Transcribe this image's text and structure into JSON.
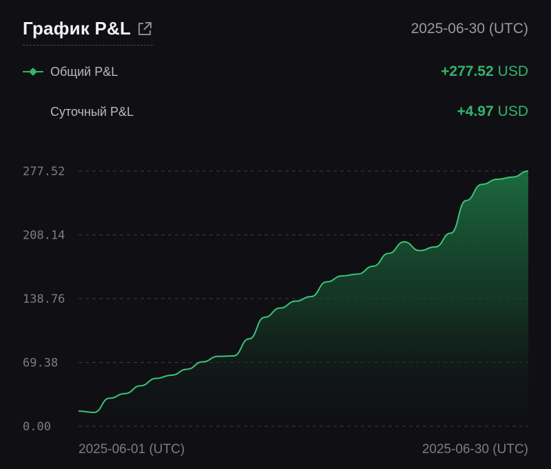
{
  "header": {
    "title": "График P&L",
    "date": "2025-06-30 (UTC)",
    "external_link_icon": "external-link-icon"
  },
  "summary": {
    "total": {
      "label": "Общий P&L",
      "value": "+277.52",
      "unit": "USD",
      "marker_icon": "diamond-line-marker"
    },
    "daily": {
      "label": "Суточный P&L",
      "value": "+4.97",
      "unit": "USD"
    }
  },
  "colors": {
    "background": "#101014",
    "accent": "#32b56b",
    "line": "#3cc478",
    "grid": "#3a3a40",
    "muted_text": "#7c7c84"
  },
  "chart_data": {
    "type": "area",
    "title": "",
    "xlabel": "",
    "ylabel": "",
    "ylim": [
      0,
      277.52
    ],
    "y_ticks": [
      0.0,
      69.38,
      138.76,
      208.14,
      277.52
    ],
    "y_tick_labels": [
      "0.00",
      "69.38",
      "138.76",
      "208.14",
      "277.52"
    ],
    "x_tick_labels": [
      "2025-06-01 (UTC)",
      "2025-06-30 (UTC)"
    ],
    "grid": true,
    "series": [
      {
        "name": "Общий P&L",
        "x": [
          "2025-06-01",
          "2025-06-02",
          "2025-06-03",
          "2025-06-04",
          "2025-06-05",
          "2025-06-06",
          "2025-06-07",
          "2025-06-08",
          "2025-06-09",
          "2025-06-10",
          "2025-06-11",
          "2025-06-12",
          "2025-06-13",
          "2025-06-14",
          "2025-06-15",
          "2025-06-16",
          "2025-06-17",
          "2025-06-18",
          "2025-06-19",
          "2025-06-20",
          "2025-06-21",
          "2025-06-22",
          "2025-06-23",
          "2025-06-24",
          "2025-06-25",
          "2025-06-26",
          "2025-06-27",
          "2025-06-28",
          "2025-06-29",
          "2025-06-30"
        ],
        "values": [
          16.5,
          15.0,
          30.5,
          35.5,
          44.0,
          52.0,
          55.5,
          62.0,
          70.0,
          76.0,
          76.5,
          95.0,
          118.5,
          128.5,
          136.0,
          141.0,
          157.0,
          163.5,
          165.5,
          174.0,
          188.0,
          200.5,
          191.0,
          195.0,
          210.0,
          245.5,
          263.0,
          268.5,
          271.0,
          277.52
        ]
      }
    ]
  }
}
